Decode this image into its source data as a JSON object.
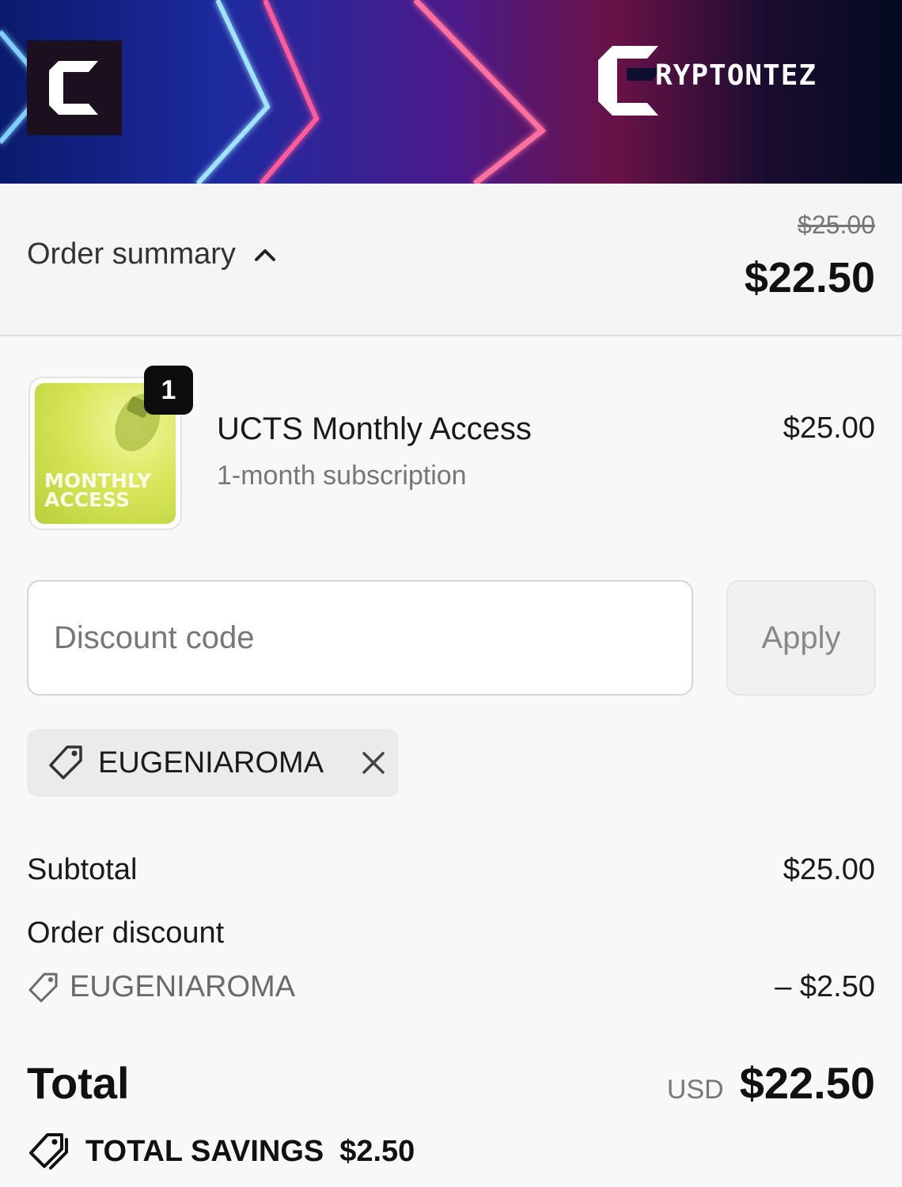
{
  "header": {
    "logo_icon": "cryptontez-c-logo-icon",
    "brand_name": "RYPTONTEZ"
  },
  "summary": {
    "toggle_label": "Order summary",
    "toggle_icon": "chevron-up-icon",
    "original_total": "$25.00",
    "total": "$22.50"
  },
  "line_item": {
    "quantity": "1",
    "thumbnail_text_line1": "MONTHLY",
    "thumbnail_text_line2": "ACCESS",
    "name": "UCTS Monthly Access",
    "variant": "1-month subscription",
    "price": "$25.00"
  },
  "discount": {
    "placeholder": "Discount code",
    "apply_label": "Apply",
    "applied_code": "EUGENIAROMA"
  },
  "totals": {
    "subtotal_label": "Subtotal",
    "subtotal_value": "$25.00",
    "order_discount_label": "Order discount",
    "discount_code": "EUGENIAROMA",
    "discount_value": "– $2.50",
    "total_label": "Total",
    "currency": "USD",
    "total_value": "$22.50",
    "savings_label": "TOTAL SAVINGS",
    "savings_value": "$2.50"
  },
  "colors": {
    "background": "#f8f8f8",
    "text": "#1a1a1a",
    "muted": "#777777",
    "badge": "#0d0d0d"
  }
}
